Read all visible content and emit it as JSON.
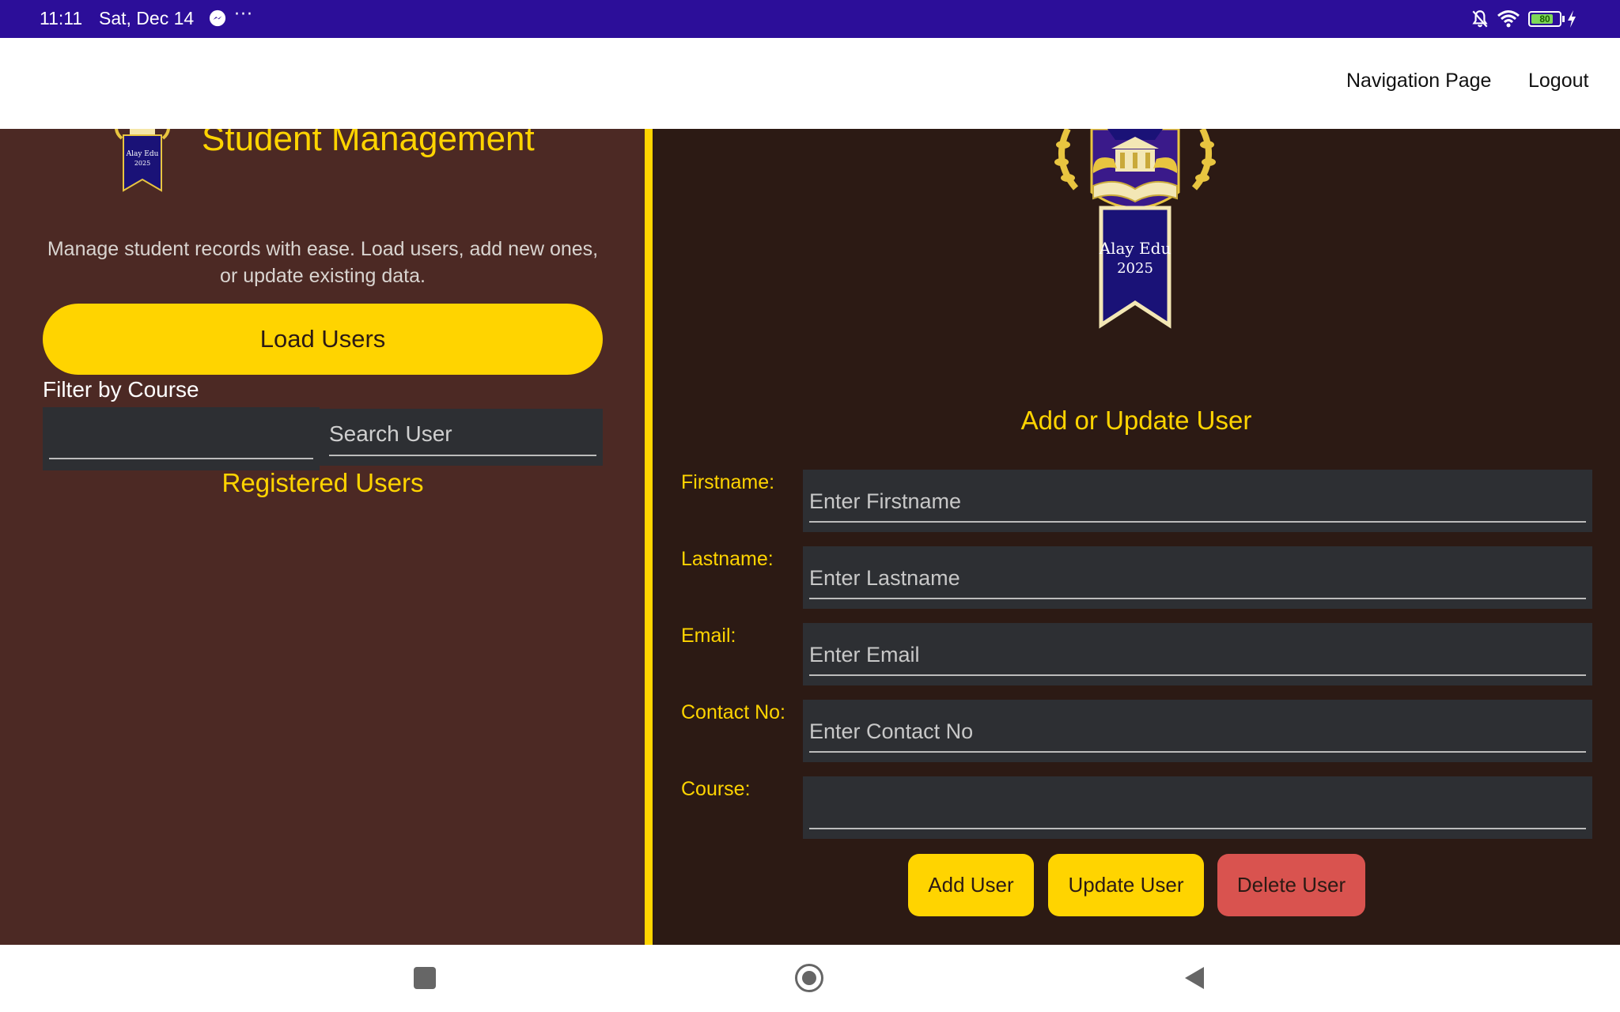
{
  "status_bar": {
    "time": "11:11",
    "date": "Sat, Dec 14",
    "more": "···",
    "battery_level": 80,
    "battery_text": "80",
    "icons": [
      "messenger-icon",
      "mute-icon",
      "wifi-icon",
      "battery-icon",
      "charging-icon"
    ]
  },
  "header": {
    "nav_links": {
      "navigation": "Navigation Page",
      "logout": "Logout"
    }
  },
  "left_panel": {
    "logo_text": "Alay Edu",
    "logo_year": "2025",
    "title": "Student Management",
    "intro": "Manage student records with ease. Load users, add new ones, or update existing data.",
    "load_button": "Load Users",
    "filter_label": "Filter by Course",
    "course_select_value": "",
    "search_placeholder": "Search User",
    "registered_heading": "Registered Users"
  },
  "right_panel": {
    "logo_text": "Alay Edu",
    "logo_year": "2025",
    "form_heading": "Add or Update User",
    "fields": {
      "firstname": {
        "label": "Firstname:",
        "placeholder": "Enter Firstname",
        "value": ""
      },
      "lastname": {
        "label": "Lastname:",
        "placeholder": "Enter Lastname",
        "value": ""
      },
      "email": {
        "label": "Email:",
        "placeholder": "Enter Email",
        "value": ""
      },
      "contact": {
        "label": "Contact No:",
        "placeholder": "Enter Contact No",
        "value": ""
      },
      "course": {
        "label": "Course:",
        "placeholder": "",
        "value": ""
      }
    },
    "buttons": {
      "add": "Add User",
      "update": "Update User",
      "delete": "Delete User"
    }
  },
  "colors": {
    "status_bar": "#2c0e99",
    "accent_yellow": "#ffd400",
    "left_panel_bg": "#4c2924",
    "right_panel_bg": "#2c1a14",
    "input_bg": "#2d2f33",
    "delete_red": "#d9534f"
  }
}
